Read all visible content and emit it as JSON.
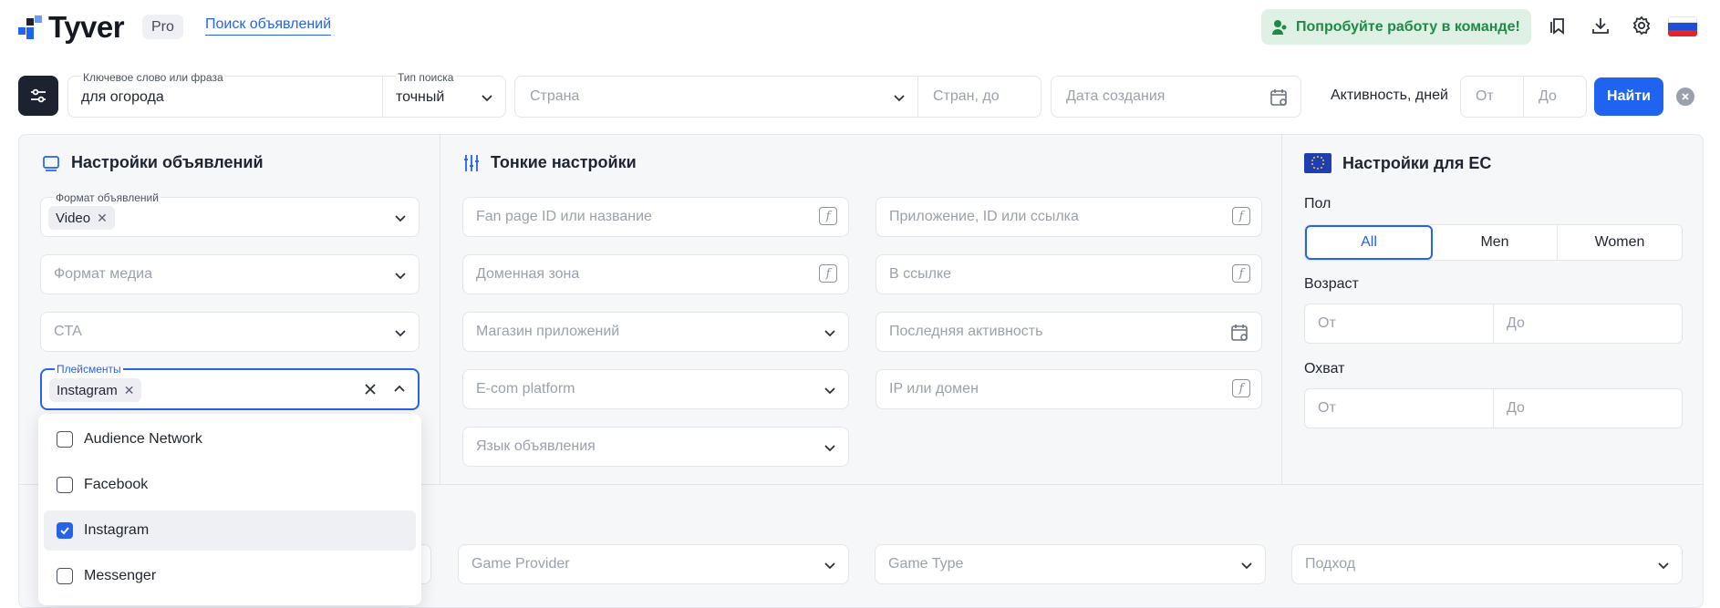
{
  "header": {
    "brand": "Tyver",
    "badge": "Pro",
    "nav_link": "Поиск объявлений",
    "team_cta": "Попробуйте работу в команде!",
    "icons": [
      "bookmarks-icon",
      "download-icon",
      "gear-icon",
      "flag-ru-icon"
    ]
  },
  "search": {
    "keyword_label": "Ключевое слово или фраза",
    "keyword_value": "для огорода",
    "type_label": "Тип поиска",
    "type_value": "точный",
    "country_placeholder": "Страна",
    "country_to_placeholder": "Стран, до",
    "date_placeholder": "Дата создания",
    "activity_label": "Активность, дней",
    "from_placeholder": "От",
    "to_placeholder": "До",
    "find_button": "Найти"
  },
  "ads_settings": {
    "title": "Настройки объявлений",
    "format_label": "Формат объявлений",
    "format_chip": "Video",
    "media_placeholder": "Формат медиа",
    "cta_placeholder": "CTA",
    "placements_label": "Плейсменты",
    "placements_chip": "Instagram",
    "options": [
      {
        "label": "Audience Network",
        "checked": false
      },
      {
        "label": "Facebook",
        "checked": false
      },
      {
        "label": "Instagram",
        "checked": true
      },
      {
        "label": "Messenger",
        "checked": false
      }
    ]
  },
  "fine_settings": {
    "title": "Тонкие настройки",
    "fanpage": "Fan page ID или название",
    "app": "Приложение, ID или ссылка",
    "domain_zone": "Доменная зона",
    "in_link": "В ссылке",
    "app_store": "Магазин приложений",
    "last_activity": "Последняя активность",
    "ecom": "E-com platform",
    "ip_domain": "IP или домен",
    "ad_language": "Язык объявления"
  },
  "eu_settings": {
    "title": "Настройки для ЕС",
    "gender_label": "Пол",
    "genders": [
      "All",
      "Men",
      "Women"
    ],
    "selected_gender": "All",
    "age_label": "Возраст",
    "reach_label": "Охват",
    "from": "От",
    "to": "До"
  },
  "bottom_row": {
    "game_provider": "Game Provider",
    "game_type": "Game Type",
    "approach": "Подход"
  },
  "colors": {
    "accent": "#2563eb",
    "team_green": "#1f8a45",
    "panel_bg": "#f6f7f9"
  }
}
